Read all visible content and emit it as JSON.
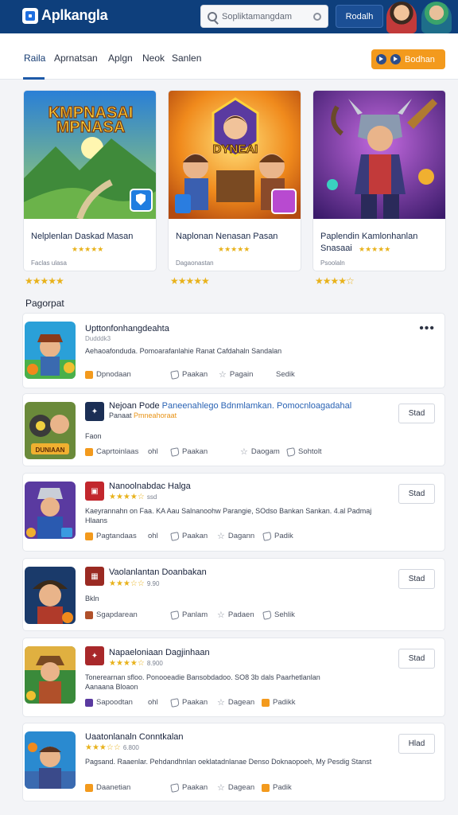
{
  "header": {
    "logo": "Aplkangla",
    "search_placeholder": "Sopliktamangdam",
    "button": "Rodalh"
  },
  "tabs": [
    "Raila",
    "Aprnatsan",
    "Aplgn",
    "Neok",
    "Sanlen"
  ],
  "promo_label": "Bodhan",
  "featured": [
    {
      "title": "Nelplenlan Daskad Masan",
      "art_text": "KMPNASAI MPNASA",
      "rating": "★★★★★",
      "sub": "Faclas ulasa",
      "stars": "★★★★★"
    },
    {
      "title": "Naplonan Nenasan Pasan",
      "art_text": "DYNEAI",
      "rating": "★★★★★",
      "sub": "Dagaonastan",
      "stars": "★★★★★"
    },
    {
      "title": "Paplendin Kamlonhanlan Snasaai",
      "rating": "★★★★★",
      "sub": "Psoolaln",
      "stars": "★★★★☆"
    }
  ],
  "section_title": "Pagorpat",
  "list": [
    {
      "title": "Upttonfonhangdeahta",
      "subtitle": "Dudddk3",
      "desc": "Aehaoafonduda. Pomoarafanlahie Ranat Cafdahaln Sandalan",
      "app": "Dpnodaan",
      "meta1": "Paakan",
      "meta2": "Pagain",
      "meta3": "Sedik",
      "button": "•••"
    },
    {
      "title": "Nejoan Pode",
      "title_hl": "Paneenahlego Bdnmlamkan. Pomocnloagadahal",
      "rating_text": "Panaat",
      "rating_hl": "Pmneahoraat",
      "desc": "Faon",
      "app": "Caprtoinlaas",
      "meta0": "ohl",
      "meta1": "Paakan",
      "meta2": "Daogam",
      "meta3": "Sohtolt",
      "button": "Stad"
    },
    {
      "title": "Nanoolnabdac Halga",
      "rating": "★★★★☆",
      "rating_num": "ssd",
      "desc": "Kaeyrannahn on Faa. KA Aau Salnanoohw Parangie, SOdso Bankan Sankan. 4.al Padmaj Hlaans",
      "app": "Pagtandaas",
      "meta0": "ohl",
      "meta1": "Paakan",
      "meta2": "Dagann",
      "meta3": "Padik",
      "button": "Stad"
    },
    {
      "title": "Vaolanlantan Doanbakan",
      "rating": "★★★☆☆",
      "rating_num": "9.90",
      "desc": "Bkln",
      "app": "Sgapdarean",
      "meta1": "Panlam",
      "meta2": "Padaen",
      "meta3": "Sehlik",
      "button": "Stad"
    },
    {
      "title": "Napaeloniaan Dagjinhaan",
      "rating": "★★★★☆",
      "rating_num": "8.900",
      "desc": "Tonerearnan sfloo. Ponooeadie Bansobdadoo. SO8 3b dals Paarhetlanlan",
      "desc2": "Aanaana Bloaon",
      "app": "Sapoodtan",
      "meta0": "ohl",
      "meta1": "Paakan",
      "meta2": "Dagean",
      "meta3": "Padikk",
      "button": "Stad"
    },
    {
      "title": "Uaatonlanaln Conntkalan",
      "rating": "★★★☆☆",
      "rating_num": "6.800",
      "desc": "Pagsand. Raaenlar. Pehdandhnlan oeklatadnlanae Denso Doknaopoeh, My Pesdig Stanst",
      "app": "Daanetian",
      "meta1": "Paakan",
      "meta2": "Dagean",
      "meta3": "Padik",
      "button": "Hlad"
    }
  ],
  "colors": {
    "header": "#0e3f7c",
    "accent": "#1e5aa8",
    "promo": "#f39a1d",
    "star": "#e8b21c"
  }
}
